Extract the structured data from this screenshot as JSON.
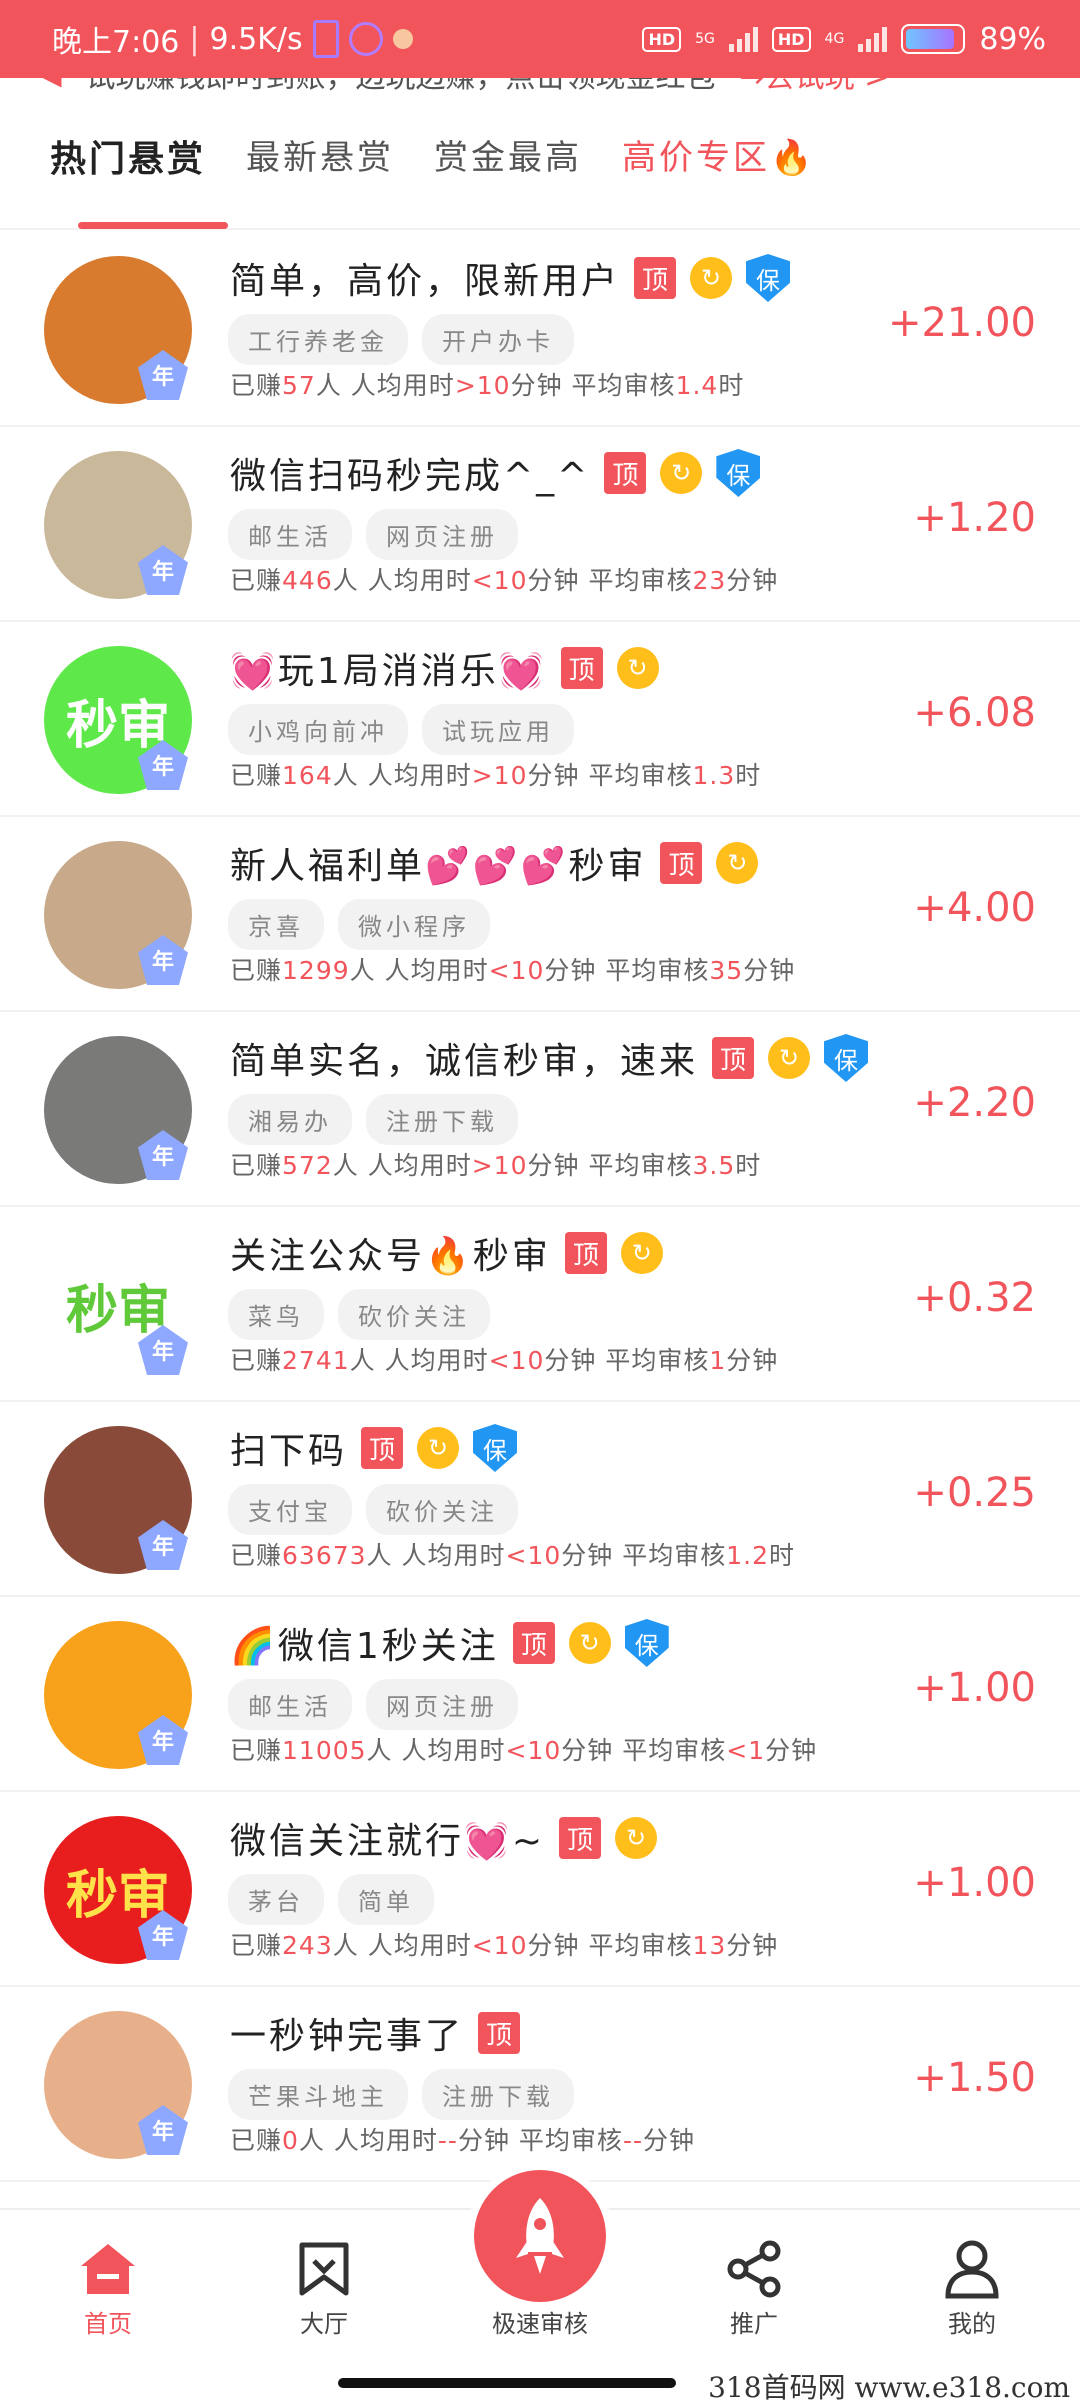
{
  "status_bar": {
    "time": "晚上7:06",
    "speed": "9.5K/s",
    "net1": "5G",
    "net2": "4G",
    "hd": "HD",
    "battery": "89%",
    "battery_level": 0.89
  },
  "notice": {
    "text": "试玩赚钱即时到账，边玩边赚，点击领现金红包",
    "action": "→去试玩 >"
  },
  "tabs": [
    {
      "label": "热门悬赏",
      "active": true
    },
    {
      "label": "最新悬赏",
      "active": false
    },
    {
      "label": "赏金最高",
      "active": false
    },
    {
      "label": "高价专区🔥",
      "active": false
    }
  ],
  "year_badge": "年",
  "badges": {
    "top": "顶",
    "bao": "保",
    "refresh": "↻"
  },
  "tasks": [
    {
      "title": "简单，高价，限新用户",
      "tags": [
        "工行养老金",
        "开户办卡"
      ],
      "earned": "57",
      "avg_time": ">10",
      "avg_time_unit": "分钟",
      "review": "1.4",
      "review_unit": "时",
      "reward": "+21.00",
      "bao": true,
      "avatar_text": "",
      "avatar_bg": "#d97b2e",
      "avatar_color": "#fff"
    },
    {
      "title": "微信扫码秒完成^_^",
      "tags": [
        "邮生活",
        "网页注册"
      ],
      "earned": "446",
      "avg_time": "<10",
      "avg_time_unit": "分钟",
      "review": "23",
      "review_unit": "分钟",
      "reward": "+1.20",
      "bao": true,
      "avatar_text": "",
      "avatar_bg": "#c9b99a",
      "avatar_color": "#fff"
    },
    {
      "title": "💓玩1局消消乐💓",
      "tags": [
        "小鸡向前冲",
        "试玩应用"
      ],
      "earned": "164",
      "avg_time": ">10",
      "avg_time_unit": "分钟",
      "review": "1.3",
      "review_unit": "时",
      "reward": "+6.08",
      "bao": false,
      "avatar_text": "秒审",
      "avatar_bg": "#5ee84a",
      "avatar_color": "#ffffff"
    },
    {
      "title": "新人福利单💕💕💕秒审",
      "tags": [
        "京喜",
        "微小程序"
      ],
      "earned": "1299",
      "avg_time": "<10",
      "avg_time_unit": "分钟",
      "review": "35",
      "review_unit": "分钟",
      "reward": "+4.00",
      "bao": false,
      "avatar_text": "",
      "avatar_bg": "#c8a98a",
      "avatar_color": "#fff"
    },
    {
      "title": "简单实名，诚信秒审，速来",
      "tags": [
        "湘易办",
        "注册下载"
      ],
      "earned": "572",
      "avg_time": ">10",
      "avg_time_unit": "分钟",
      "review": "3.5",
      "review_unit": "时",
      "reward": "+2.20",
      "bao": true,
      "avatar_text": "",
      "avatar_bg": "#7a7a78",
      "avatar_color": "#fff"
    },
    {
      "title": "关注公众号🔥秒审",
      "tags": [
        "菜鸟",
        "砍价关注"
      ],
      "earned": "2741",
      "avg_time": "<10",
      "avg_time_unit": "分钟",
      "review": "1",
      "review_unit": "分钟",
      "reward": "+0.32",
      "bao": false,
      "avatar_text": "秒审",
      "avatar_bg": "#ffffff",
      "avatar_color": "#5fc93a"
    },
    {
      "title": "扫下码",
      "tags": [
        "支付宝",
        "砍价关注"
      ],
      "earned": "63673",
      "avg_time": "<10",
      "avg_time_unit": "分钟",
      "review": "1.2",
      "review_unit": "时",
      "reward": "+0.25",
      "bao": true,
      "avatar_text": "",
      "avatar_bg": "#8a4a3a",
      "avatar_color": "#fff"
    },
    {
      "title": "🌈微信1秒关注",
      "tags": [
        "邮生活",
        "网页注册"
      ],
      "earned": "11005",
      "avg_time": "<10",
      "avg_time_unit": "分钟",
      "review": "<1",
      "review_unit": "分钟",
      "reward": "+1.00",
      "bao": true,
      "avatar_text": "",
      "avatar_bg": "#f7a21a",
      "avatar_color": "#fff"
    },
    {
      "title": "微信关注就行💓~",
      "tags": [
        "茅台",
        "简单"
      ],
      "earned": "243",
      "avg_time": "<10",
      "avg_time_unit": "分钟",
      "review": "13",
      "review_unit": "分钟",
      "reward": "+1.00",
      "bao": false,
      "avatar_text": "秒审",
      "avatar_bg": "#e81e1e",
      "avatar_color": "#ffe14a"
    },
    {
      "title": "一秒钟完事了",
      "tags": [
        "芒果斗地主",
        "注册下载"
      ],
      "earned": "0",
      "avg_time": "--",
      "avg_time_unit": "分钟",
      "review": "--",
      "review_unit": "分钟",
      "reward": "+1.50",
      "bao": false,
      "no_refresh": true,
      "avatar_text": "",
      "avatar_bg": "#e8b08a",
      "avatar_color": "#fff"
    }
  ],
  "meta_labels": {
    "earned_prefix": "已赚",
    "earned_suffix": "人",
    "avg_label": "人均用时",
    "review_label": "平均审核"
  },
  "bottom_nav": {
    "home": "首页",
    "hall": "大厅",
    "fast": "极速审核",
    "promote": "推广",
    "mine": "我的"
  },
  "watermark": "318首码网  www.e318.com",
  "colors": {
    "accent": "#f2545b",
    "yellow": "#ffbe1a",
    "blue": "#2196f3"
  }
}
